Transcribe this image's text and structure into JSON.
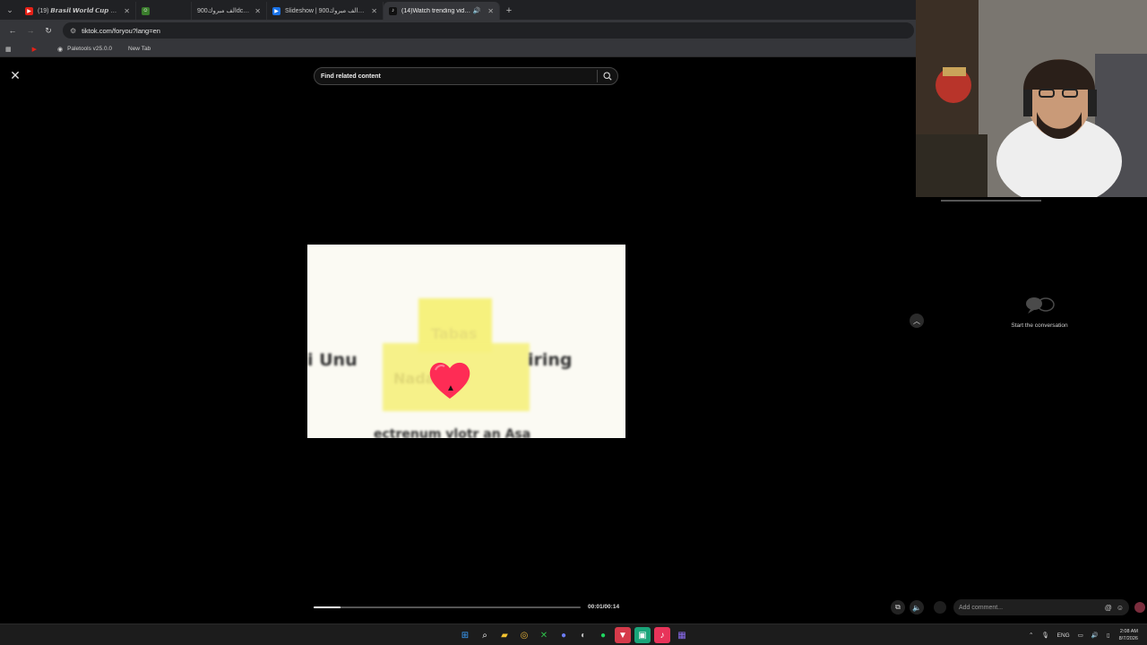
{
  "browser": {
    "tabs": [
      {
        "title": "(19) 𝘽𝙧𝙖𝙨𝙞𝙡 𝙒𝙤𝙧𝙡𝙙 𝘾𝙪𝙥 𝙎𝙤𝙣𝙜",
        "icon": "youtube-icon",
        "color": "#e62117",
        "audio": ""
      },
      {
        "title": "",
        "icon": "cat-face-icon",
        "color": "#3a7d2c",
        "audio": ""
      },
      {
        "title": "الف مبروك900dcssss",
        "icon": "",
        "color": "#202124",
        "audio": ""
      },
      {
        "title": "Slideshow | 900الف مبروكdcssss",
        "icon": "slideshow-icon",
        "color": "#1a73e8",
        "audio": ""
      },
      {
        "title": "(14)Watch trending videos",
        "icon": "tiktok-icon",
        "color": "#111111",
        "audio": "🔊"
      }
    ],
    "url": "tiktok.com/foryou?lang=en",
    "bookmarks": [
      {
        "label": "Paletools v25.0.0",
        "icon": "paletools-icon"
      },
      {
        "label": "New Tab",
        "icon": ""
      }
    ]
  },
  "page": {
    "search_placeholder": "Find related content",
    "video": {
      "overlay_text_left": "i Unu",
      "overlay_text_right": "iring",
      "overlay_text_top": "Tabas",
      "overlay_text_mid": "Nadakaie",
      "overlay_text_bottom": "ectrenum vlotr an Asa",
      "progress": 0.1,
      "timecode": "00:01/00:14"
    },
    "conversation_label": "Start the conversation",
    "comment_placeholder": "Add comment..."
  },
  "taskbar": {
    "language": "ENG",
    "time": "2:08 AM",
    "date": "8/7/2026"
  },
  "colors": {
    "accent": "#fe2c55",
    "heart": "#fe2c55",
    "video_highlight": "#f6f17e"
  }
}
